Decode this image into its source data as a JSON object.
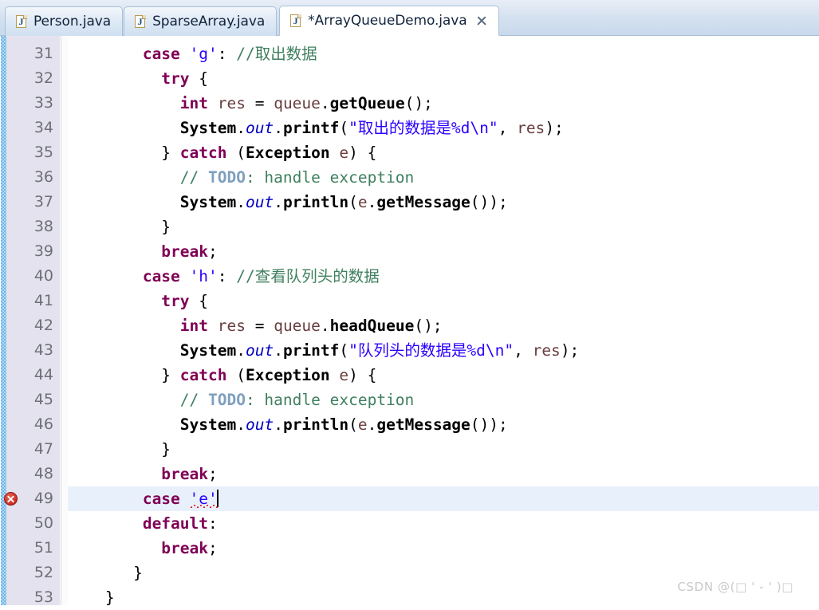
{
  "window": {
    "kind": "java-code-editor",
    "colors": {
      "tabbar_bg": "#d3e0ef",
      "active_tab_bg": "#ffffff",
      "gutter_bg": "#e4e2ee",
      "change_bar": "#6db3e8",
      "current_line": "#e8f1fb",
      "keyword": "#7f0055",
      "string": "#2a00ff",
      "comment": "#3f7f5f",
      "todo_tag": "#7f9fbf",
      "static_field": "#0000c0",
      "local_var": "#6a3e3e",
      "error_red": "#cf2f26"
    }
  },
  "tabs": [
    {
      "label": "Person.java",
      "icon": "java-file-icon",
      "letter": "J",
      "active": false,
      "dirty": false,
      "closable": false
    },
    {
      "label": "SparseArray.java",
      "icon": "java-file-icon",
      "letter": "J",
      "active": false,
      "dirty": false,
      "closable": false
    },
    {
      "label": "*ArrayQueueDemo.java",
      "icon": "java-file-icon",
      "letter": "J",
      "active": true,
      "dirty": true,
      "closable": true,
      "close_icon": "close-icon"
    }
  ],
  "editor": {
    "first_visible_line": 31,
    "current_line": 49,
    "error_line": 49,
    "error_marker_icon": "error-marker-icon",
    "caret_line": 49,
    "lines": [
      {
        "no": 31,
        "indent": 8,
        "tokens": [
          {
            "t": "case",
            "c": "kw"
          },
          {
            "t": " ",
            "c": "plain"
          },
          {
            "t": "'g'",
            "c": "chr"
          },
          {
            "t": ":",
            "c": "plain"
          },
          {
            "t": " ",
            "c": "plain"
          },
          {
            "t": "//取出数据",
            "c": "cmt"
          }
        ]
      },
      {
        "no": 32,
        "indent": 10,
        "tokens": [
          {
            "t": "try",
            "c": "kw"
          },
          {
            "t": " {",
            "c": "plain"
          }
        ]
      },
      {
        "no": 33,
        "indent": 12,
        "tokens": [
          {
            "t": "int",
            "c": "kw"
          },
          {
            "t": " ",
            "c": "plain"
          },
          {
            "t": "res",
            "c": "lvar"
          },
          {
            "t": " = ",
            "c": "plain"
          },
          {
            "t": "queue",
            "c": "lvar"
          },
          {
            "t": ".",
            "c": "plain"
          },
          {
            "t": "getQueue",
            "c": "cls"
          },
          {
            "t": "();",
            "c": "plain"
          }
        ]
      },
      {
        "no": 34,
        "indent": 12,
        "tokens": [
          {
            "t": "System",
            "c": "cls"
          },
          {
            "t": ".",
            "c": "plain"
          },
          {
            "t": "out",
            "c": "stat"
          },
          {
            "t": ".",
            "c": "plain"
          },
          {
            "t": "printf",
            "c": "cls"
          },
          {
            "t": "(",
            "c": "plain"
          },
          {
            "t": "\"取出的数据是%d\\n\"",
            "c": "chr"
          },
          {
            "t": ", ",
            "c": "plain"
          },
          {
            "t": "res",
            "c": "lvar"
          },
          {
            "t": ");",
            "c": "plain"
          }
        ]
      },
      {
        "no": 35,
        "indent": 10,
        "tokens": [
          {
            "t": "} ",
            "c": "plain"
          },
          {
            "t": "catch",
            "c": "kw"
          },
          {
            "t": " (",
            "c": "plain"
          },
          {
            "t": "Exception",
            "c": "cls"
          },
          {
            "t": " ",
            "c": "plain"
          },
          {
            "t": "e",
            "c": "lvar"
          },
          {
            "t": ") {",
            "c": "plain"
          }
        ]
      },
      {
        "no": 36,
        "indent": 12,
        "tokens": [
          {
            "t": "// ",
            "c": "cmt"
          },
          {
            "t": "TODO",
            "c": "todo"
          },
          {
            "t": ": handle exception",
            "c": "cmt"
          }
        ]
      },
      {
        "no": 37,
        "indent": 12,
        "tokens": [
          {
            "t": "System",
            "c": "cls"
          },
          {
            "t": ".",
            "c": "plain"
          },
          {
            "t": "out",
            "c": "stat"
          },
          {
            "t": ".",
            "c": "plain"
          },
          {
            "t": "println",
            "c": "cls"
          },
          {
            "t": "(",
            "c": "plain"
          },
          {
            "t": "e",
            "c": "lvar"
          },
          {
            "t": ".",
            "c": "plain"
          },
          {
            "t": "getMessage",
            "c": "cls"
          },
          {
            "t": "());",
            "c": "plain"
          }
        ]
      },
      {
        "no": 38,
        "indent": 10,
        "tokens": [
          {
            "t": "}",
            "c": "plain"
          }
        ]
      },
      {
        "no": 39,
        "indent": 10,
        "tokens": [
          {
            "t": "break",
            "c": "kw"
          },
          {
            "t": ";",
            "c": "plain"
          }
        ]
      },
      {
        "no": 40,
        "indent": 8,
        "tokens": [
          {
            "t": "case",
            "c": "kw"
          },
          {
            "t": " ",
            "c": "plain"
          },
          {
            "t": "'h'",
            "c": "chr"
          },
          {
            "t": ":",
            "c": "plain"
          },
          {
            "t": " ",
            "c": "plain"
          },
          {
            "t": "//查看队列头的数据",
            "c": "cmt"
          }
        ]
      },
      {
        "no": 41,
        "indent": 10,
        "tokens": [
          {
            "t": "try",
            "c": "kw"
          },
          {
            "t": " {",
            "c": "plain"
          }
        ]
      },
      {
        "no": 42,
        "indent": 12,
        "tokens": [
          {
            "t": "int",
            "c": "kw"
          },
          {
            "t": " ",
            "c": "plain"
          },
          {
            "t": "res",
            "c": "lvar"
          },
          {
            "t": " = ",
            "c": "plain"
          },
          {
            "t": "queue",
            "c": "lvar"
          },
          {
            "t": ".",
            "c": "plain"
          },
          {
            "t": "headQueue",
            "c": "cls"
          },
          {
            "t": "();",
            "c": "plain"
          }
        ]
      },
      {
        "no": 43,
        "indent": 12,
        "tokens": [
          {
            "t": "System",
            "c": "cls"
          },
          {
            "t": ".",
            "c": "plain"
          },
          {
            "t": "out",
            "c": "stat"
          },
          {
            "t": ".",
            "c": "plain"
          },
          {
            "t": "printf",
            "c": "cls"
          },
          {
            "t": "(",
            "c": "plain"
          },
          {
            "t": "\"队列头的数据是%d\\n\"",
            "c": "chr"
          },
          {
            "t": ", ",
            "c": "plain"
          },
          {
            "t": "res",
            "c": "lvar"
          },
          {
            "t": ");",
            "c": "plain"
          }
        ]
      },
      {
        "no": 44,
        "indent": 10,
        "tokens": [
          {
            "t": "} ",
            "c": "plain"
          },
          {
            "t": "catch",
            "c": "kw"
          },
          {
            "t": " (",
            "c": "plain"
          },
          {
            "t": "Exception",
            "c": "cls"
          },
          {
            "t": " ",
            "c": "plain"
          },
          {
            "t": "e",
            "c": "lvar"
          },
          {
            "t": ") {",
            "c": "plain"
          }
        ]
      },
      {
        "no": 45,
        "indent": 12,
        "tokens": [
          {
            "t": "// ",
            "c": "cmt"
          },
          {
            "t": "TODO",
            "c": "todo"
          },
          {
            "t": ": handle exception",
            "c": "cmt"
          }
        ]
      },
      {
        "no": 46,
        "indent": 12,
        "tokens": [
          {
            "t": "System",
            "c": "cls"
          },
          {
            "t": ".",
            "c": "plain"
          },
          {
            "t": "out",
            "c": "stat"
          },
          {
            "t": ".",
            "c": "plain"
          },
          {
            "t": "println",
            "c": "cls"
          },
          {
            "t": "(",
            "c": "plain"
          },
          {
            "t": "e",
            "c": "lvar"
          },
          {
            "t": ".",
            "c": "plain"
          },
          {
            "t": "getMessage",
            "c": "cls"
          },
          {
            "t": "());",
            "c": "plain"
          }
        ]
      },
      {
        "no": 47,
        "indent": 10,
        "tokens": [
          {
            "t": "}",
            "c": "plain"
          }
        ]
      },
      {
        "no": 48,
        "indent": 10,
        "tokens": [
          {
            "t": "break",
            "c": "kw"
          },
          {
            "t": ";",
            "c": "plain"
          }
        ]
      },
      {
        "no": 49,
        "indent": 8,
        "tokens": [
          {
            "t": "case",
            "c": "kw"
          },
          {
            "t": " ",
            "c": "plain"
          },
          {
            "t": "'e'",
            "c": "chr",
            "squiggle": true
          },
          {
            "t": "",
            "c": "plain",
            "caret": true
          }
        ]
      },
      {
        "no": 50,
        "indent": 8,
        "tokens": [
          {
            "t": "default",
            "c": "kw"
          },
          {
            "t": ":",
            "c": "plain"
          }
        ]
      },
      {
        "no": 51,
        "indent": 10,
        "tokens": [
          {
            "t": "break",
            "c": "kw"
          },
          {
            "t": ";",
            "c": "plain"
          }
        ]
      },
      {
        "no": 52,
        "indent": 7,
        "tokens": [
          {
            "t": "}",
            "c": "plain"
          }
        ]
      },
      {
        "no": 53,
        "indent": 4,
        "tokens": [
          {
            "t": "}",
            "c": "plain"
          }
        ]
      }
    ]
  },
  "watermark": {
    "text": "CSDN @(□ ' - ' )□"
  }
}
